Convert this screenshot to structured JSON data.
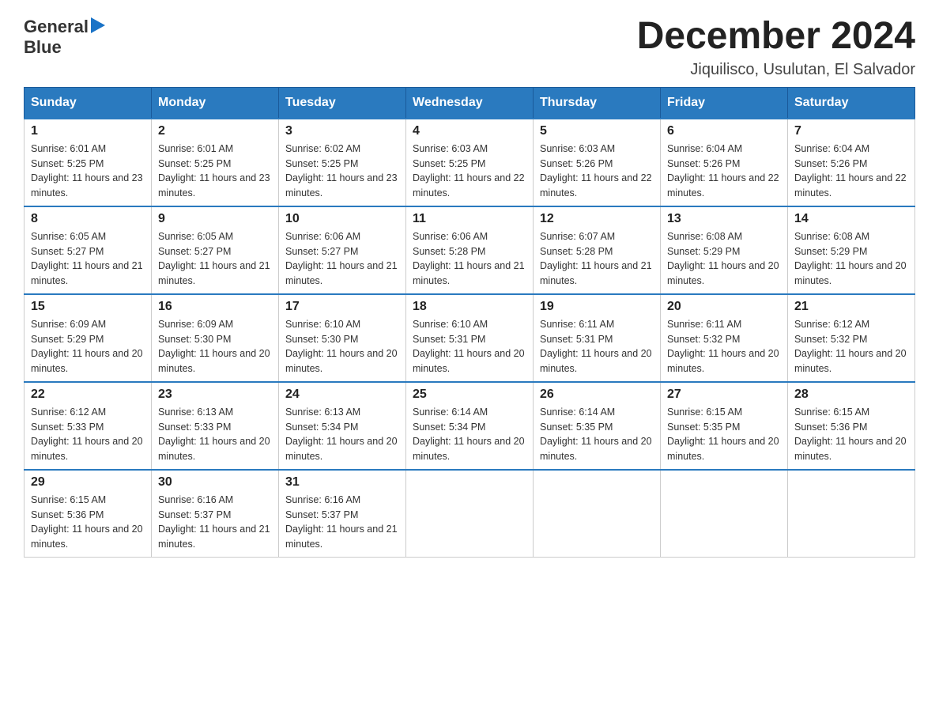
{
  "logo": {
    "text_general": "General",
    "text_blue": "Blue"
  },
  "header": {
    "month_title": "December 2024",
    "location": "Jiquilisco, Usulutan, El Salvador"
  },
  "days_of_week": [
    "Sunday",
    "Monday",
    "Tuesday",
    "Wednesday",
    "Thursday",
    "Friday",
    "Saturday"
  ],
  "weeks": [
    [
      {
        "day": "1",
        "sunrise": "6:01 AM",
        "sunset": "5:25 PM",
        "daylight": "11 hours and 23 minutes."
      },
      {
        "day": "2",
        "sunrise": "6:01 AM",
        "sunset": "5:25 PM",
        "daylight": "11 hours and 23 minutes."
      },
      {
        "day": "3",
        "sunrise": "6:02 AM",
        "sunset": "5:25 PM",
        "daylight": "11 hours and 23 minutes."
      },
      {
        "day": "4",
        "sunrise": "6:03 AM",
        "sunset": "5:25 PM",
        "daylight": "11 hours and 22 minutes."
      },
      {
        "day": "5",
        "sunrise": "6:03 AM",
        "sunset": "5:26 PM",
        "daylight": "11 hours and 22 minutes."
      },
      {
        "day": "6",
        "sunrise": "6:04 AM",
        "sunset": "5:26 PM",
        "daylight": "11 hours and 22 minutes."
      },
      {
        "day": "7",
        "sunrise": "6:04 AM",
        "sunset": "5:26 PM",
        "daylight": "11 hours and 22 minutes."
      }
    ],
    [
      {
        "day": "8",
        "sunrise": "6:05 AM",
        "sunset": "5:27 PM",
        "daylight": "11 hours and 21 minutes."
      },
      {
        "day": "9",
        "sunrise": "6:05 AM",
        "sunset": "5:27 PM",
        "daylight": "11 hours and 21 minutes."
      },
      {
        "day": "10",
        "sunrise": "6:06 AM",
        "sunset": "5:27 PM",
        "daylight": "11 hours and 21 minutes."
      },
      {
        "day": "11",
        "sunrise": "6:06 AM",
        "sunset": "5:28 PM",
        "daylight": "11 hours and 21 minutes."
      },
      {
        "day": "12",
        "sunrise": "6:07 AM",
        "sunset": "5:28 PM",
        "daylight": "11 hours and 21 minutes."
      },
      {
        "day": "13",
        "sunrise": "6:08 AM",
        "sunset": "5:29 PM",
        "daylight": "11 hours and 20 minutes."
      },
      {
        "day": "14",
        "sunrise": "6:08 AM",
        "sunset": "5:29 PM",
        "daylight": "11 hours and 20 minutes."
      }
    ],
    [
      {
        "day": "15",
        "sunrise": "6:09 AM",
        "sunset": "5:29 PM",
        "daylight": "11 hours and 20 minutes."
      },
      {
        "day": "16",
        "sunrise": "6:09 AM",
        "sunset": "5:30 PM",
        "daylight": "11 hours and 20 minutes."
      },
      {
        "day": "17",
        "sunrise": "6:10 AM",
        "sunset": "5:30 PM",
        "daylight": "11 hours and 20 minutes."
      },
      {
        "day": "18",
        "sunrise": "6:10 AM",
        "sunset": "5:31 PM",
        "daylight": "11 hours and 20 minutes."
      },
      {
        "day": "19",
        "sunrise": "6:11 AM",
        "sunset": "5:31 PM",
        "daylight": "11 hours and 20 minutes."
      },
      {
        "day": "20",
        "sunrise": "6:11 AM",
        "sunset": "5:32 PM",
        "daylight": "11 hours and 20 minutes."
      },
      {
        "day": "21",
        "sunrise": "6:12 AM",
        "sunset": "5:32 PM",
        "daylight": "11 hours and 20 minutes."
      }
    ],
    [
      {
        "day": "22",
        "sunrise": "6:12 AM",
        "sunset": "5:33 PM",
        "daylight": "11 hours and 20 minutes."
      },
      {
        "day": "23",
        "sunrise": "6:13 AM",
        "sunset": "5:33 PM",
        "daylight": "11 hours and 20 minutes."
      },
      {
        "day": "24",
        "sunrise": "6:13 AM",
        "sunset": "5:34 PM",
        "daylight": "11 hours and 20 minutes."
      },
      {
        "day": "25",
        "sunrise": "6:14 AM",
        "sunset": "5:34 PM",
        "daylight": "11 hours and 20 minutes."
      },
      {
        "day": "26",
        "sunrise": "6:14 AM",
        "sunset": "5:35 PM",
        "daylight": "11 hours and 20 minutes."
      },
      {
        "day": "27",
        "sunrise": "6:15 AM",
        "sunset": "5:35 PM",
        "daylight": "11 hours and 20 minutes."
      },
      {
        "day": "28",
        "sunrise": "6:15 AM",
        "sunset": "5:36 PM",
        "daylight": "11 hours and 20 minutes."
      }
    ],
    [
      {
        "day": "29",
        "sunrise": "6:15 AM",
        "sunset": "5:36 PM",
        "daylight": "11 hours and 20 minutes."
      },
      {
        "day": "30",
        "sunrise": "6:16 AM",
        "sunset": "5:37 PM",
        "daylight": "11 hours and 21 minutes."
      },
      {
        "day": "31",
        "sunrise": "6:16 AM",
        "sunset": "5:37 PM",
        "daylight": "11 hours and 21 minutes."
      },
      null,
      null,
      null,
      null
    ]
  ]
}
